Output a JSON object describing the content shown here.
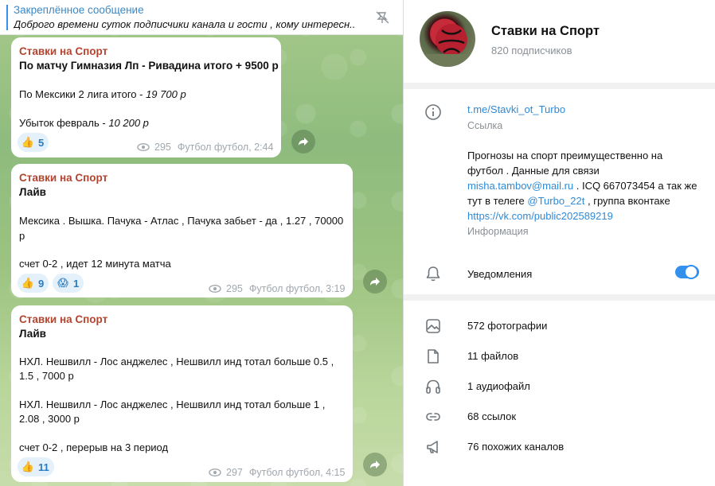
{
  "pinned": {
    "title": "Закреплённое сообщение",
    "text": "Доброго времени суток подписчики канала и гости , кому интересн..."
  },
  "messages": [
    {
      "sender": "Ставки на Спорт",
      "lines": [
        "По матчу Гимназия Лп - Ривадина итого + 9500 р",
        "По Мексики 2 лига итого - 19 700 р",
        "Убыток февраль - 10 200 р"
      ],
      "reactions": [
        {
          "emoji": "👍",
          "count": "5"
        }
      ],
      "views": "295",
      "signature": "Футбол футбол, 2:44"
    },
    {
      "sender": "Ставки на Спорт",
      "lines": [
        "Лайв",
        "Мексика . Вышка. Пачука - Атлас , Пачука забьет - да , 1.27 , 70000",
        "р",
        "счет 0-2 , идет 12 минута матча"
      ],
      "reactions": [
        {
          "emoji": "👍",
          "count": "9"
        },
        {
          "emoji": "😱",
          "count": "1"
        }
      ],
      "views": "295",
      "signature": "Футбол футбол, 3:19"
    },
    {
      "sender": "Ставки на Спорт",
      "lines": [
        "Лайв",
        "НХЛ. Нешвилл - Лос анджелес , Нешвилл инд тотал больше 0.5 ,",
        "1.5 , 7000 р",
        "НХЛ. Нешвилл - Лос анджелес , Нешвилл инд тотал больше 1 ,",
        "2.08 , 3000 р",
        "счет 0-2 , перерыв на 3 период"
      ],
      "reactions": [
        {
          "emoji": "👍",
          "count": "11"
        }
      ],
      "views": "297",
      "signature": "Футбол футбол, 4:15"
    }
  ],
  "channel": {
    "name": "Ставки на Спорт",
    "subscribers": "820 подписчиков"
  },
  "about": {
    "link": "t.me/Stavki_ot_Turbo",
    "link_caption": "Ссылка",
    "desc_1": "Прогнозы на спорт преимущественно на футбол .   Данные для связи ",
    "desc_email": "misha.tambov@mail.ru",
    "desc_2": " . ICQ 667073454 а так же тут в телеге ",
    "desc_mention": "@Turbo_22t",
    "desc_3": " , группа вконтаке ",
    "desc_vk": "https://vk.com/public202589219",
    "desc_caption": "Информация",
    "notifications": "Уведомления",
    "notifications_on": true
  },
  "media": [
    {
      "icon": "photo-icon",
      "label": "572 фотографии"
    },
    {
      "icon": "file-icon",
      "label": "11 файлов"
    },
    {
      "icon": "headphones-icon",
      "label": "1 аудиофайл"
    },
    {
      "icon": "link-icon",
      "label": "68 ссылок"
    },
    {
      "icon": "megaphone-icon",
      "label": "76 похожих каналов"
    }
  ],
  "colors": {
    "accent": "#3390ec",
    "sender": "#b3442f",
    "link": "#2f8ad8"
  }
}
